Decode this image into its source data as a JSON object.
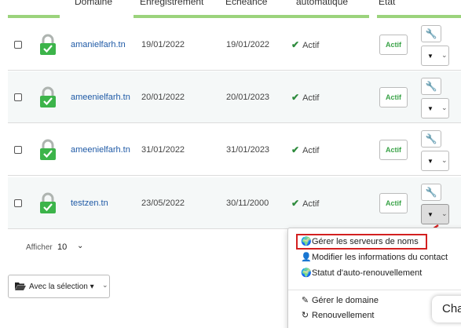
{
  "table": {
    "headers": [
      "Domaine",
      "Enregistrement",
      "Echéance",
      "automatique",
      "Etat"
    ],
    "rows": [
      {
        "domain": "amanielfarh.tn",
        "registered": "19/01/2022",
        "expires": "19/01/2022",
        "auto_renew": "Actif",
        "state": "Actif"
      },
      {
        "domain": "ameenielfarh.tn",
        "registered": "20/01/2022",
        "expires": "20/01/2023",
        "auto_renew": "Actif",
        "state": "Actif"
      },
      {
        "domain": "ameenielfarh.tn",
        "registered": "31/01/2022",
        "expires": "31/01/2023",
        "auto_renew": "Actif",
        "state": "Actif"
      },
      {
        "domain": "testzen.tn",
        "registered": "23/05/2022",
        "expires": "30/11/2000",
        "auto_renew": "Actif",
        "state": "Actif"
      }
    ]
  },
  "footer": {
    "show_label": "Afficher",
    "per_page": "10",
    "bulk_action_label": "Avec la sélection"
  },
  "dropdown_menu": {
    "items": [
      {
        "label": "Gérer les serveurs de noms",
        "icon": "globe-icon",
        "highlighted": true
      },
      {
        "label": "Modifier les informations du contact",
        "icon": "user-icon",
        "highlighted": false
      },
      {
        "label": "Statut d'auto-renouvellement",
        "icon": "globe-icon",
        "highlighted": false
      },
      {
        "label": "Gérer le domaine",
        "icon": "pencil-icon",
        "highlighted": false
      },
      {
        "label": "Renouvellement",
        "icon": "refresh-icon",
        "highlighted": false
      }
    ]
  },
  "chat_widget": {
    "label": "Cha"
  },
  "colors": {
    "accent_green": "#9bd37c",
    "lock_green": "#3cb44a",
    "link_blue": "#1f5aa6",
    "highlight_red": "#d32020"
  }
}
